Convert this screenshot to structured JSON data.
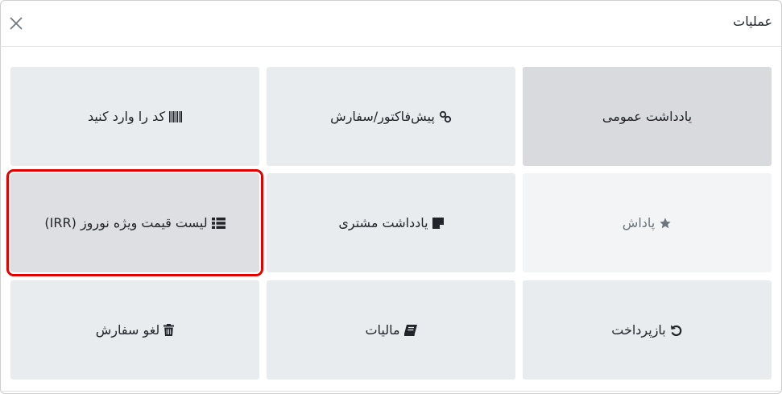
{
  "dialog": {
    "title": "عملیات"
  },
  "actions": [
    {
      "id": "general-note",
      "label": "یادداشت عمومی",
      "icon": "none"
    },
    {
      "id": "quotation",
      "label": "پیش‌فاکتور/سفارش",
      "icon": "link-icon"
    },
    {
      "id": "enter-code",
      "label": "کد را وارد کنید",
      "icon": "barcode-icon"
    },
    {
      "id": "reward",
      "label": "پاداش",
      "icon": "star-icon"
    },
    {
      "id": "customer-note",
      "label": "یادداشت مشتری",
      "icon": "note-icon"
    },
    {
      "id": "pricelist",
      "label": "لیست قیمت ویژه نوروز (IRR)",
      "icon": "list-icon"
    },
    {
      "id": "refund",
      "label": "بازپرداخت",
      "icon": "undo-icon"
    },
    {
      "id": "taxes",
      "label": "مالیات",
      "icon": "book-icon"
    },
    {
      "id": "cancel-order",
      "label": "لغو سفارش",
      "icon": "trash-icon"
    }
  ]
}
